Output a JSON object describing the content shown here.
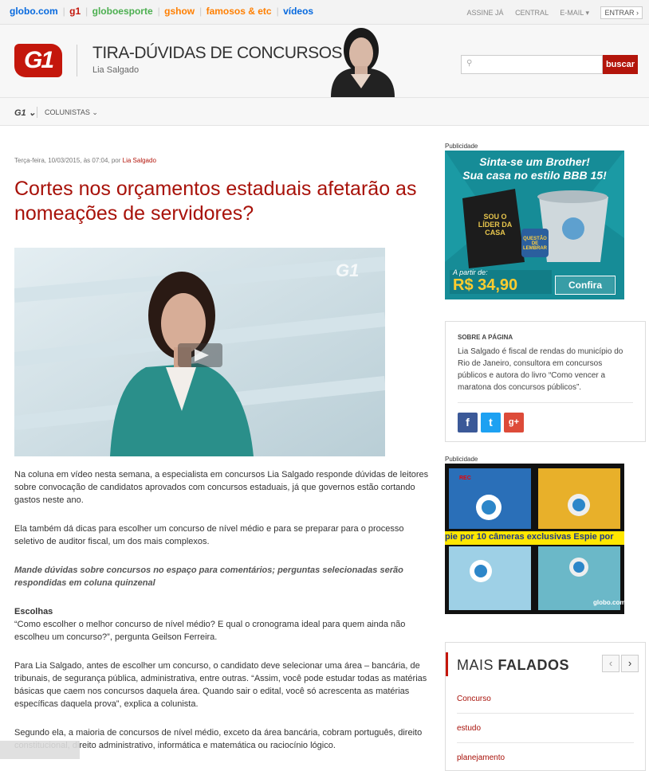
{
  "topbar": {
    "links": [
      {
        "label": "globo.com",
        "color": "#0669de"
      },
      {
        "label": "g1",
        "color": "#c4170c"
      },
      {
        "label": "globoesporte",
        "color": "#4caf50"
      },
      {
        "label": "gshow",
        "color": "#ff7f00"
      },
      {
        "label": "famosos & etc",
        "color": "#ff7f00"
      },
      {
        "label": "vídeos",
        "color": "#0669de"
      }
    ],
    "assine": "ASSINE JÁ",
    "central": "CENTRAL",
    "email": "E-MAIL",
    "entrar": "ENTRAR"
  },
  "header": {
    "logo": "G1",
    "blog_title": "TIRA-DÚVIDAS DE CONCURSOS",
    "author": "Lia Salgado",
    "search_button": "buscar"
  },
  "nav": {
    "g1": "G1",
    "colunistas": "COLUNISTAS"
  },
  "article": {
    "meta_prefix": "Terça-feira, 10/03/2015, às 07:04, por ",
    "meta_author": "Lia Salgado",
    "headline": "Cortes nos orçamentos estaduais afetarão as nomeações de servidores?",
    "video_logo": "G1",
    "p1": "Na coluna em vídeo nesta semana, a especialista em concursos Lia Salgado responde dúvidas de leitores sobre convocação de candidatos aprovados com concursos estaduais, já que governos estão cortando gastos neste ano.",
    "p2": "Ela também dá dicas para escolher um concurso de nível médio e para se preparar para o processo seletivo de auditor fiscal, um dos mais complexos.",
    "p3": "Mande dúvidas sobre concursos no espaço para comentários; perguntas selecionadas serão respondidas em coluna quinzenal",
    "h_escolhas": "Escolhas",
    "p4": "“Como escolher o melhor concurso de nível médio? E qual o cronograma ideal para quem ainda não escolheu um concurso?”, pergunta Geilson Ferreira.",
    "p5": "Para Lia Salgado, antes de escolher um concurso, o candidato deve selecionar uma área – bancária, de tribunais, de segurança pública, administrativa, entre outras. “Assim, você pode estudar todas as matérias básicas que caem nos concursos daquela área. Quando sair o edital, você só acrescenta as matérias específicas daquela prova”, explica a colunista.",
    "p6": "Segundo ela, a maioria de concursos de nível médio, exceto da área bancária, cobram português, direito constitucional, direito administrativo, informática e matemática ou raciocínio lógico."
  },
  "sidebar": {
    "pub1": "Publicidade",
    "ad1_line1": "Sinta-se um Brother!",
    "ad1_line2": "Sua casa no estilo BBB 15!",
    "ad1_pillow": "SOU O LÍDER DA CASA",
    "ad1_mug": "QUESTÃO DE LEMBRAR",
    "ad1_from": "A partir de:",
    "ad1_price": "R$ 34,90",
    "ad1_button": "Confira",
    "about_title": "SOBRE A PÁGINA",
    "about_text": "Lia Salgado é fiscal de rendas do município do Rio de Janeiro, consultora em concursos públicos e autora do livro “Como vencer a maratona dos concursos públicos”.",
    "social": [
      {
        "label": "f",
        "color": "#3b5998"
      },
      {
        "label": "t",
        "color": "#1da1f2"
      },
      {
        "label": "g+",
        "color": "#dd4b39"
      }
    ],
    "pub2": "Publicidade",
    "ad2_band": "pie por 10 câmeras exclusivas   Espie por",
    "ad2_rec": "REC",
    "ad2_logo": "globo.com",
    "mais_light": "MAIS",
    "mais_bold": "FALADOS",
    "mais_items": [
      "Concurso",
      "estudo",
      "planejamento"
    ]
  }
}
